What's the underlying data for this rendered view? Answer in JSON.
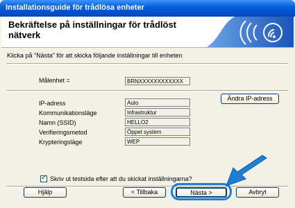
{
  "window": {
    "title": "Installationsguide för trådlösa enheter"
  },
  "header": {
    "title": "Bekräftelse på inställningar för trådlöst nätverk"
  },
  "instruction": "Klicka på \"Nästa\" för att skicka följande inställningar till enheten",
  "target_device": {
    "label": "Målenhet =",
    "value": "BRNXXXXXXXXXXXX"
  },
  "settings": [
    {
      "label": "IP-adress",
      "value": "Auto"
    },
    {
      "label": "Kommunikationsläge",
      "value": "Infrastruktur"
    },
    {
      "label": "Namn (SSID)",
      "value": "HELLO2"
    },
    {
      "label": "Verifieringsmetod",
      "value": "Öppet system"
    },
    {
      "label": "Krypteringsläge",
      "value": "WEP"
    }
  ],
  "change_ip_button": "Ändra IP-adress",
  "print_checkbox": {
    "label": "Skriv ut testsida efter att du skickat inställningarna?",
    "checked": true
  },
  "footer": {
    "help": "Hjälp",
    "back": "< Tillbaka",
    "next": "Nästa >",
    "cancel": "Avbryt"
  },
  "colors": {
    "titlebar": "#0a5fd8",
    "header_brand": "#1b63c6",
    "arrow": "#1d7fd1"
  },
  "icons": {
    "header_logo": "wireless-signal-icon",
    "pointer": "arrow-icon"
  }
}
